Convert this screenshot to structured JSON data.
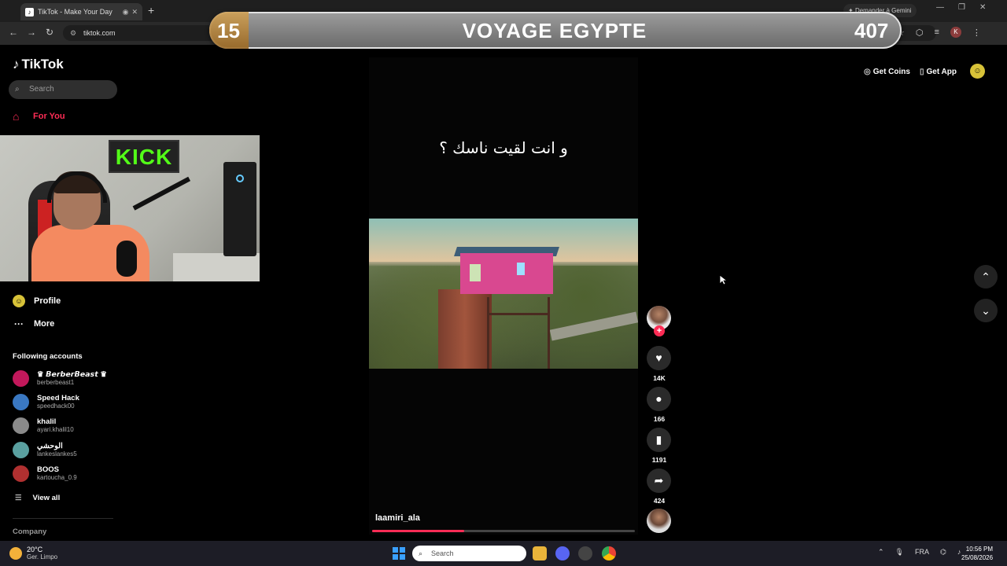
{
  "browser": {
    "tab_title": "TikTok - Make Your Day",
    "url": "tiktok.com",
    "gemini_label": "Demander à Gemini"
  },
  "overlay": {
    "left_number": "15",
    "title": "VOYAGE EGYPTE",
    "right_number": "407"
  },
  "tiktok": {
    "logo": "TikTok",
    "search_placeholder": "Search",
    "nav": {
      "for_you": "For You",
      "profile": "Profile",
      "more": "More"
    },
    "following_header": "Following accounts",
    "accounts": [
      {
        "name": "♛ 𝘽𝙚𝙧𝙗𝙚𝙧𝘽𝙚𝙖𝙨𝙩 ♛",
        "handle": "berberbeast1",
        "color": "#c2185b"
      },
      {
        "name": "Speed Hack",
        "handle": "speedhack00",
        "color": "#3a78c2"
      },
      {
        "name": "khalil",
        "handle": "ayari.khalil10",
        "color": "#8a8a8a"
      },
      {
        "name": "الوحشي",
        "handle": "lankeslankes5",
        "color": "#5aa0a0"
      },
      {
        "name": "BOOS",
        "handle": "kartoucha_0.9",
        "color": "#b03030"
      }
    ],
    "view_all": "View all",
    "company": "Company",
    "top_right": {
      "get_coins": "Get Coins",
      "get_app": "Get App"
    }
  },
  "webcam": {
    "sign": "KICK"
  },
  "video": {
    "caption": "و انت لقيت ناسك ؟",
    "username": "laamiri_ala",
    "progress": 0.35,
    "likes": "14K",
    "comments": "166",
    "saves": "1191",
    "shares": "424"
  },
  "taskbar": {
    "temperature": "20°C",
    "weather": "Ger. Limpo",
    "search_placeholder": "Search",
    "language": "FRA",
    "time": "10:56 PM",
    "date": "25/08/2026"
  },
  "icons": {
    "accent": "#fe2c55"
  }
}
